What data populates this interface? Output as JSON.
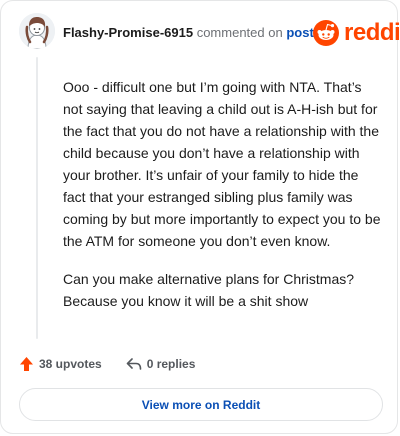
{
  "comment": {
    "author": "Flashy-Promise-6915",
    "action_text": "commented on",
    "post_link_label": "post",
    "avatar_icon": "avatar-icon",
    "paragraphs": [
      "Ooo - difficult one but I’m going with NTA. That’s not saying that leaving a child out is A-H-ish but for the fact that you do not have a relationship with the child because you don’t have a relationship with your brother. It’s unfair of your family to hide the fact that your estranged sibling plus family was coming by but more importantly to expect you to be the ATM for someone you don’t even know.",
      "Can you make alternative plans for Christmas? Because you know it will be a shit show"
    ]
  },
  "brand": {
    "name": "reddit",
    "icon": "reddit-logo-icon",
    "color": "#ff4500"
  },
  "actions": {
    "upvotes_label": "38 upvotes",
    "replies_label": "0 replies",
    "upvote_icon": "upvote-arrow-icon",
    "reply_icon": "reply-arrow-icon"
  },
  "footer": {
    "view_more_label": "View more on Reddit",
    "link_color": "#0a4fb5"
  }
}
